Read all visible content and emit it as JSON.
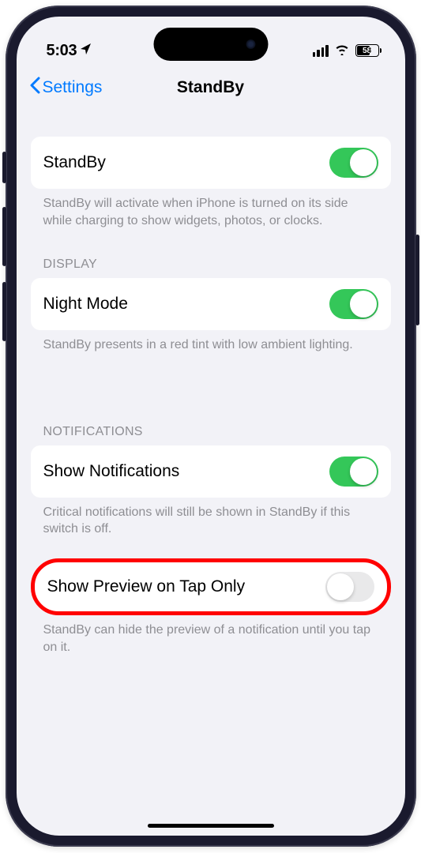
{
  "status": {
    "time": "5:03",
    "battery": "58"
  },
  "nav": {
    "back": "Settings",
    "title": "StandBy"
  },
  "sections": {
    "main": {
      "standby_label": "StandBy",
      "standby_on": true,
      "standby_footer": "StandBy will activate when iPhone is turned on its side while charging to show widgets, photos, or clocks."
    },
    "display": {
      "header": "DISPLAY",
      "nightmode_label": "Night Mode",
      "nightmode_on": true,
      "nightmode_footer": "StandBy presents in a red tint with low ambient lighting."
    },
    "notifications": {
      "header": "NOTIFICATIONS",
      "shownotif_label": "Show Notifications",
      "shownotif_on": true,
      "shownotif_footer": "Critical notifications will still be shown in StandBy if this switch is off.",
      "preview_label": "Show Preview on Tap Only",
      "preview_on": false,
      "preview_footer": "StandBy can hide the preview of a notification until you tap on it."
    }
  }
}
